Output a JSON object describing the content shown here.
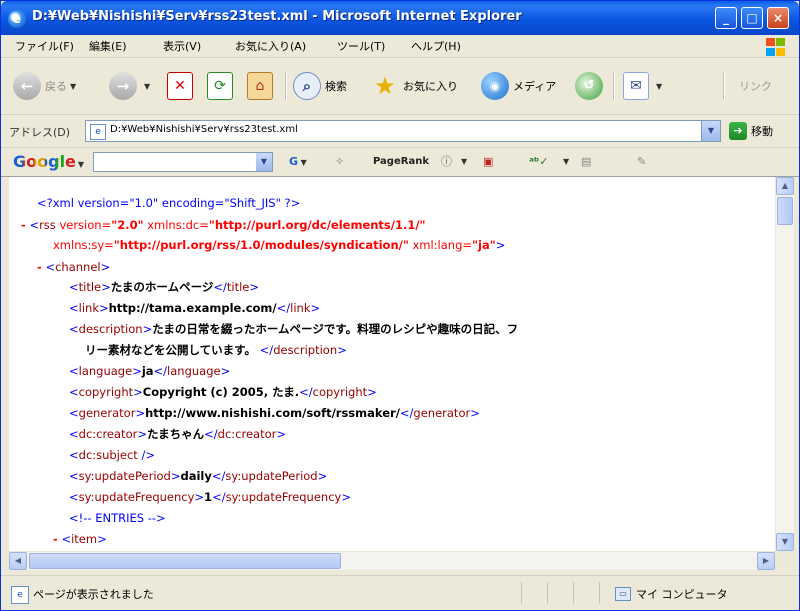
{
  "window": {
    "title": "D:¥Web¥Nishishi¥Serv¥rss23test.xml - Microsoft Internet Explorer",
    "minimize": "_",
    "maximize": "□",
    "close": "×"
  },
  "menu": [
    "ファイル(F)",
    "編集(E)",
    "表示(V)",
    "お気に入り(A)",
    "ツール(T)",
    "ヘルプ(H)"
  ],
  "toolbar": {
    "back": "戻る",
    "search": "検索",
    "favorites": "お気に入り",
    "media": "メディア",
    "links": "リンク"
  },
  "address": {
    "label": "アドレス(D)",
    "value": "D:¥Web¥Nishishi¥Serv¥rss23test.xml",
    "go": "移動"
  },
  "google": {
    "logo": "Google",
    "pagerank": "PageRank"
  },
  "xml": {
    "decl": "<?xml version=\"1.0\" encoding=\"Shift_JIS\" ?>",
    "rss_open": {
      "dash": "-",
      "lt": "<",
      "tag": "rss",
      "attr1_name": " version=",
      "attr1_value": "\"2.0\"",
      "attr2_name": " xmlns:dc=",
      "attr2_value": "\"http://purl.org/dc/elements/1.1/\""
    },
    "rss_open2": {
      "attr3_name": "xmlns:sy=",
      "attr3_value": "\"http://purl.org/rss/1.0/modules/syndication/\"",
      "attr4_name": " xml:lang=",
      "attr4_value": "\"ja\"",
      "gt": ">"
    },
    "channel": {
      "dash": "-",
      "tag": "channel"
    },
    "title": {
      "tag": "title",
      "text": "たまのホームページ"
    },
    "link": {
      "tag": "link",
      "text": "http://tama.example.com/"
    },
    "description": {
      "tag": "description",
      "text1": "たまの日常を綴ったホームページです。料理のレシピや趣味の日記、フ",
      "text2": "リー素材などを公開しています。"
    },
    "language": {
      "tag": "language",
      "text": "ja"
    },
    "copyright": {
      "tag": "copyright",
      "text": "Copyright (c) 2005, たま."
    },
    "generator": {
      "tag": "generator",
      "text": "http://www.nishishi.com/soft/rssmaker/"
    },
    "creator": {
      "tag": "dc:creator",
      "text": "たまちゃん"
    },
    "subject": {
      "tag": "dc:subject",
      "close": " />"
    },
    "updatePeriod": {
      "tag": "sy:updatePeriod",
      "text": "daily"
    },
    "updateFrequency": {
      "tag": "sy:updateFrequency",
      "text": "1"
    },
    "comment": "<!--  ENTRIES  -->",
    "item": {
      "dash": "-",
      "tag": "item"
    }
  },
  "status": {
    "text": "ページが表示されました",
    "zone": "マイ コンピュータ"
  },
  "colors": {
    "titlebar": "#0b56e0",
    "markup_blue": "#0000ff",
    "tag_red": "#990000",
    "attr_red": "#ff0000",
    "chrome": "#ece9d8"
  }
}
